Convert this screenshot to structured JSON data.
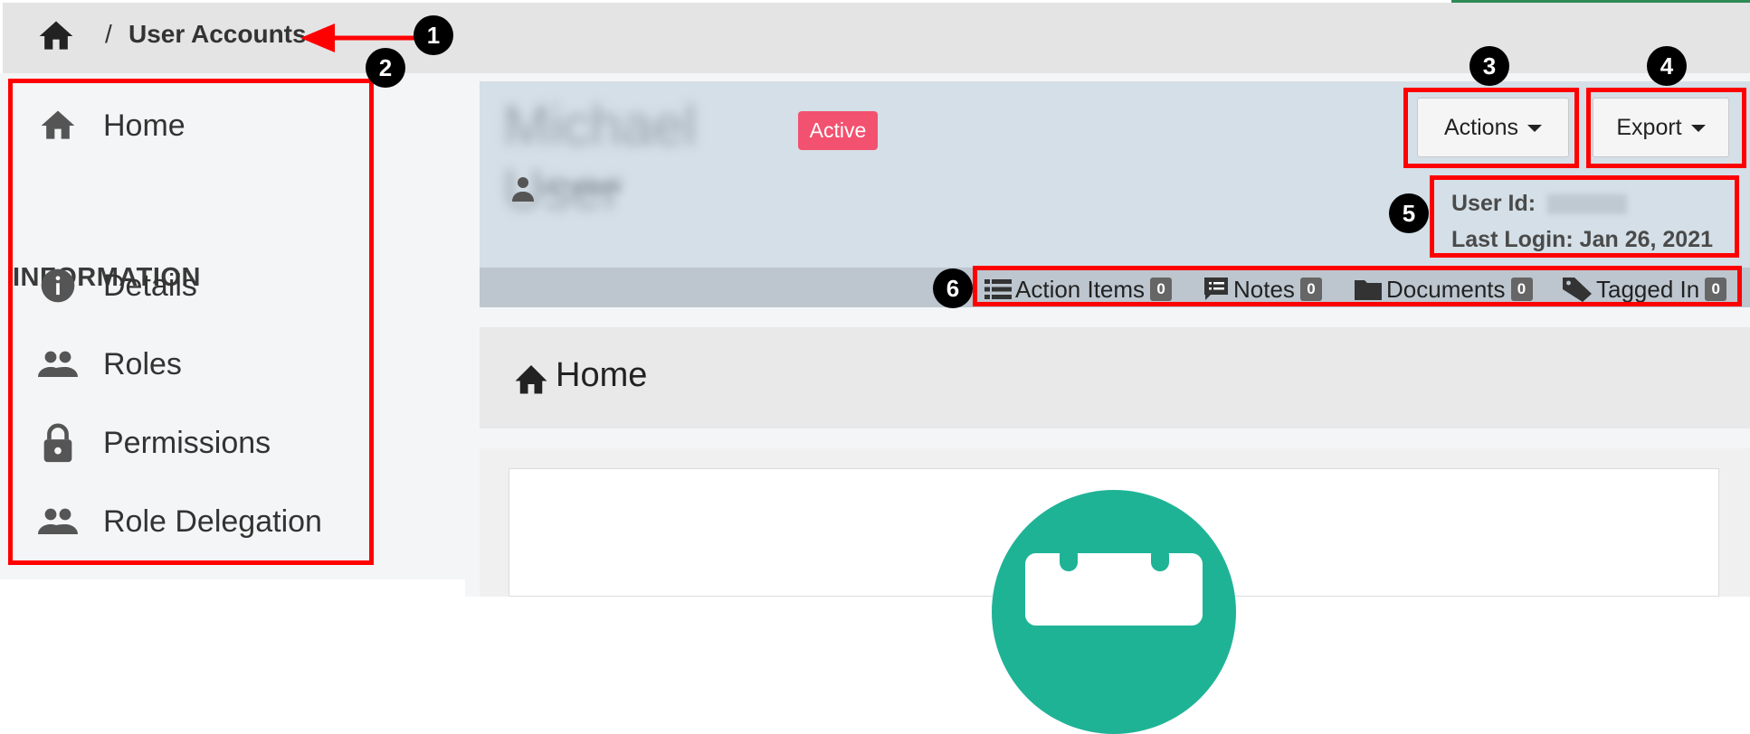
{
  "breadcrumb": {
    "separator": "/",
    "current": "User Accounts"
  },
  "sidebar": {
    "home_label": "Home",
    "section_heading": "INFORMATION",
    "items": [
      {
        "label": "Details",
        "icon": "info-circle-icon"
      },
      {
        "label": "Roles",
        "icon": "people-icon"
      },
      {
        "label": "Permissions",
        "icon": "lock-icon"
      },
      {
        "label": "Role Delegation",
        "icon": "people-icon"
      }
    ]
  },
  "header": {
    "name": "Michael User",
    "status": "Active",
    "username": "U1T99BBN",
    "actions_label": "Actions",
    "export_label": "Export",
    "user_id_label": "User Id:",
    "last_login_label": "Last Login:",
    "last_login_value": "Jan 26, 2021"
  },
  "tabs": [
    {
      "label": "Action Items",
      "count": "0",
      "icon": "list-icon"
    },
    {
      "label": "Notes",
      "count": "0",
      "icon": "note-icon"
    },
    {
      "label": "Documents",
      "count": "0",
      "icon": "folder-icon"
    },
    {
      "label": "Tagged In",
      "count": "0",
      "icon": "tag-icon"
    }
  ],
  "section": {
    "title": "Home"
  },
  "annotations": [
    "1",
    "2",
    "3",
    "4",
    "5",
    "6"
  ],
  "colors": {
    "annotation_red": "#ff0000",
    "status_badge": "#f2516f",
    "header_bg": "#d4dfe7",
    "teal": "#1fb396"
  }
}
